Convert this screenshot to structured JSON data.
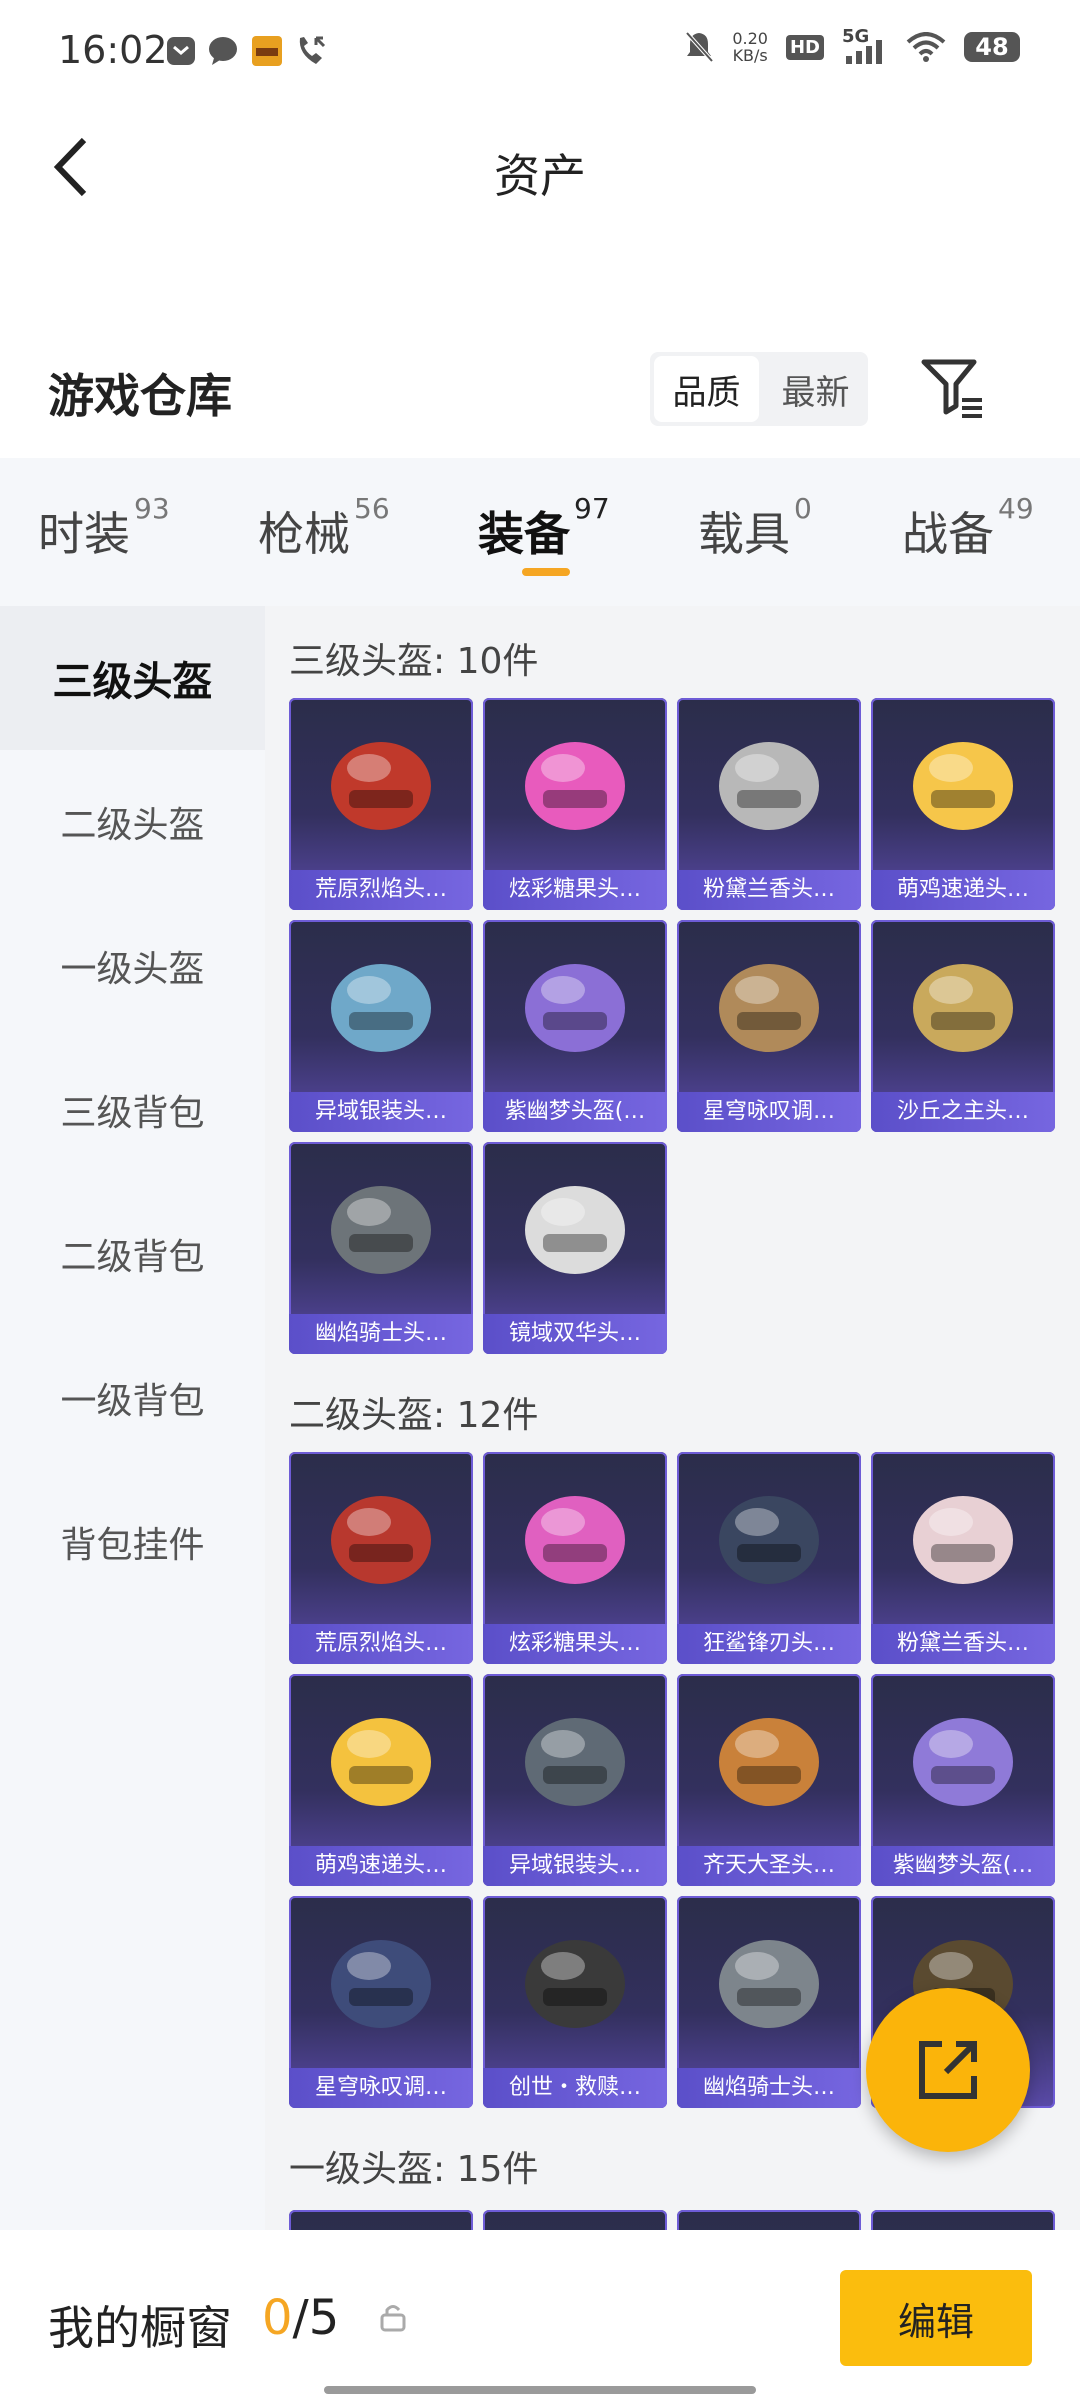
{
  "status_bar": {
    "time": "16:02",
    "net_speed_value": "0.20",
    "net_speed_unit": "KB/s",
    "network": "5G",
    "hd": "HD",
    "battery": "48"
  },
  "header": {
    "title": "资产"
  },
  "warehouse": {
    "title": "游戏仓库",
    "sort_options": [
      "品质",
      "最新"
    ],
    "active_sort": "品质"
  },
  "tabs": [
    {
      "label": "时装",
      "count": "93"
    },
    {
      "label": "枪械",
      "count": "56"
    },
    {
      "label": "装备",
      "count": "97"
    },
    {
      "label": "载具",
      "count": "0"
    },
    {
      "label": "战备",
      "count": "49"
    }
  ],
  "active_tab": "装备",
  "sidebar": [
    "三级头盔",
    "二级头盔",
    "一级头盔",
    "三级背包",
    "二级背包",
    "一级背包",
    "背包挂件"
  ],
  "active_sidebar": "三级头盔",
  "sections": [
    {
      "title": "三级头盔: 10件",
      "items": [
        "荒原烈焰头…",
        "炫彩糖果头…",
        "粉黛兰香头…",
        "萌鸡速递头…",
        "异域银装头…",
        "紫幽梦头盔(…",
        "星穹咏叹调…",
        "沙丘之主头…",
        "幽焰骑士头…",
        "镜域双华头…"
      ]
    },
    {
      "title": "二级头盔: 12件",
      "items": [
        "荒原烈焰头…",
        "炫彩糖果头…",
        "狂鲨锋刃头…",
        "粉黛兰香头…",
        "萌鸡速递头…",
        "异域银装头…",
        "齐天大圣头…",
        "紫幽梦头盔(…",
        "星穹咏叹调…",
        "创世・救赎…",
        "幽焰骑士头…",
        ""
      ]
    },
    {
      "title": "一级头盔: 15件",
      "items": []
    }
  ],
  "bottom_bar": {
    "label": "我的橱窗",
    "count_current": "0",
    "count_sep": "/",
    "count_total": "5",
    "edit_label": "编辑"
  },
  "colors": {
    "accent": "#fbbd0d",
    "card_label": "#6a5cd6",
    "card_bg": "#2b2d4a"
  },
  "icons": {
    "helmet_colors_s1": [
      "#c0392b",
      "#e85bbd",
      "#b8b8b8",
      "#f6c64a",
      "#6fa8c9",
      "#8b6fd6",
      "#b08a5a",
      "#c9a95c",
      "#6d7479",
      "#dcdcdc"
    ],
    "helmet_colors_s2": [
      "#b8382e",
      "#e060c0",
      "#3a4660",
      "#e8d0d4",
      "#f4c23e",
      "#5f6a75",
      "#c9813a",
      "#8f7ad8",
      "#3e4c7a",
      "#3a3a3a",
      "#7d858c",
      "#5a4a30"
    ]
  }
}
